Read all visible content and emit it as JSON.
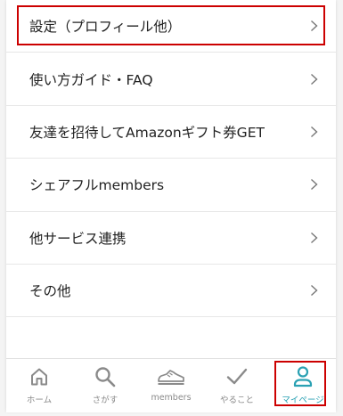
{
  "menu": {
    "items": [
      {
        "label": "設定（プロフィール他）",
        "highlighted": true
      },
      {
        "label": "使い方ガイド・FAQ"
      },
      {
        "label": "友達を招待してAmazonギフト券GET"
      },
      {
        "label": "シェアフルmembers"
      },
      {
        "label": "他サービス連携"
      },
      {
        "label": "その他"
      }
    ]
  },
  "tabbar": {
    "tabs": [
      {
        "label": "ホーム",
        "icon": "home-icon"
      },
      {
        "label": "さがす",
        "icon": "search-icon"
      },
      {
        "label": "members",
        "icon": "sneaker-icon"
      },
      {
        "label": "やること",
        "icon": "check-icon"
      },
      {
        "label": "マイページ",
        "icon": "person-icon",
        "active": true
      }
    ]
  },
  "colors": {
    "accent": "#2aa1b3",
    "inactive": "#8a8a8a",
    "highlight_border": "#cc0000",
    "divider": "#e7e7e7"
  }
}
